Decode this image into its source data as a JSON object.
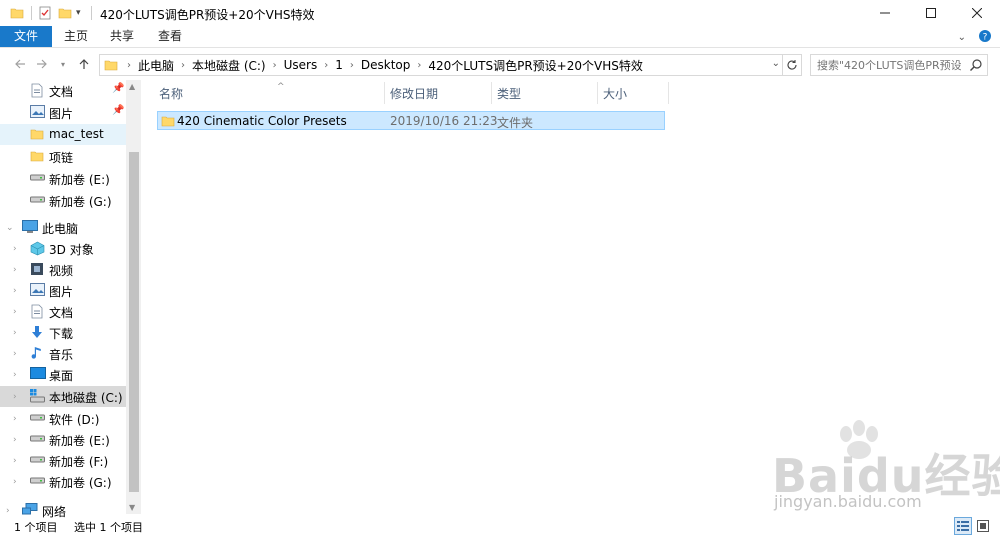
{
  "window": {
    "title": "420个LUTS调色PR预设+20个VHS特效",
    "controls": {
      "minimize": "—",
      "maximize": "☐",
      "close": "✕"
    }
  },
  "ribbon": {
    "tabs": [
      {
        "label": "文件",
        "active": true
      },
      {
        "label": "主页"
      },
      {
        "label": "共享"
      },
      {
        "label": "查看"
      }
    ]
  },
  "address": {
    "crumbs": [
      "此电脑",
      "本地磁盘 (C:)",
      "Users",
      "1",
      "Desktop",
      "420个LUTS调色PR预设+20个VHS特效"
    ]
  },
  "search": {
    "placeholder": "搜索\"420个LUTS调色PR预设..."
  },
  "nav": {
    "quick": [
      {
        "label": "文档",
        "icon": "document-icon",
        "pinned": true
      },
      {
        "label": "图片",
        "icon": "pictures-icon",
        "pinned": true
      },
      {
        "label": "mac_test",
        "icon": "folder-icon",
        "selected": true
      },
      {
        "label": "项链",
        "icon": "folder-icon"
      },
      {
        "label": "新加卷 (E:)",
        "icon": "drive-icon"
      },
      {
        "label": "新加卷 (G:)",
        "icon": "drive-icon"
      }
    ],
    "this_pc": {
      "label": "此电脑",
      "icon": "computer-icon"
    },
    "pc_items": [
      {
        "label": "3D 对象",
        "icon": "cube-icon"
      },
      {
        "label": "视频",
        "icon": "video-icon"
      },
      {
        "label": "图片",
        "icon": "pictures-icon"
      },
      {
        "label": "文档",
        "icon": "document-icon"
      },
      {
        "label": "下载",
        "icon": "download-icon"
      },
      {
        "label": "音乐",
        "icon": "music-icon"
      },
      {
        "label": "桌面",
        "icon": "desktop-icon"
      },
      {
        "label": "本地磁盘 (C:)",
        "icon": "system-drive-icon",
        "selected": true
      },
      {
        "label": "软件 (D:)",
        "icon": "drive-icon"
      },
      {
        "label": "新加卷 (E:)",
        "icon": "drive-icon"
      },
      {
        "label": "新加卷 (F:)",
        "icon": "drive-icon"
      },
      {
        "label": "新加卷 (G:)",
        "icon": "drive-icon"
      }
    ],
    "network": {
      "label": "网络",
      "icon": "network-icon"
    }
  },
  "list": {
    "columns": [
      "名称",
      "修改日期",
      "类型",
      "大小"
    ],
    "rows": [
      {
        "name": "420 Cinematic Color Presets",
        "date": "2019/10/16 21:23",
        "type": "文件夹",
        "size": ""
      }
    ]
  },
  "status": {
    "count": "1 个项目",
    "selected": "选中 1 个项目"
  },
  "watermark": {
    "text": "Baidu经验",
    "url": "jingyan.baidu.com"
  },
  "colors": {
    "accent": "#1979ca",
    "selection": "#cce8ff",
    "selection_border": "#99d1ff",
    "nav_hover": "#e5f3fb",
    "header_text": "#4c607a",
    "folder": "#ffd869"
  }
}
